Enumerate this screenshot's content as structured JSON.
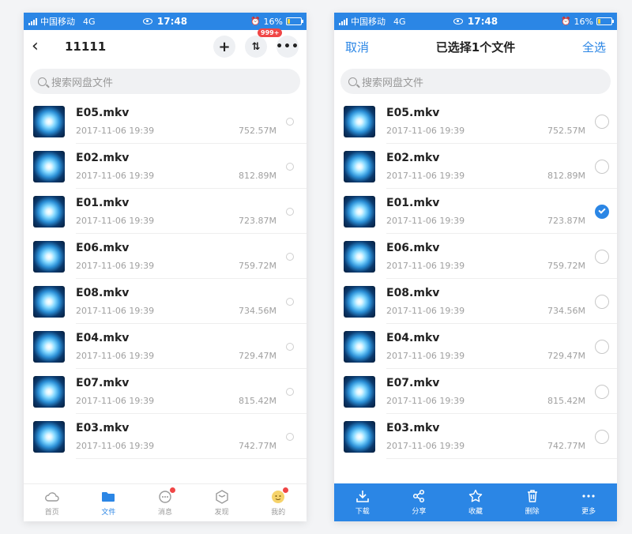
{
  "status_bar": {
    "carrier": "中国移动",
    "network": "4G",
    "time": "17:48",
    "battery": "16%"
  },
  "left": {
    "folder_title": "11111",
    "badge": "999+",
    "search_placeholder": "搜索网盘文件",
    "tabs": [
      {
        "label": "首页",
        "icon": "cloud-icon"
      },
      {
        "label": "文件",
        "icon": "folder-icon"
      },
      {
        "label": "消息",
        "icon": "message-icon"
      },
      {
        "label": "发现",
        "icon": "discover-icon"
      },
      {
        "label": "我的",
        "icon": "profile-icon"
      }
    ]
  },
  "right": {
    "cancel": "取消",
    "title": "已选择1个文件",
    "select_all": "全选",
    "search_placeholder": "搜索网盘文件",
    "actions": [
      {
        "label": "下载",
        "icon": "download-icon"
      },
      {
        "label": "分享",
        "icon": "share-icon"
      },
      {
        "label": "收藏",
        "icon": "star-icon"
      },
      {
        "label": "删除",
        "icon": "trash-icon"
      },
      {
        "label": "更多",
        "icon": "more-icon"
      }
    ]
  },
  "files": [
    {
      "name": "E05.mkv",
      "date": "2017-11-06 19:39",
      "size": "752.57M",
      "selected": false
    },
    {
      "name": "E02.mkv",
      "date": "2017-11-06 19:39",
      "size": "812.89M",
      "selected": false
    },
    {
      "name": "E01.mkv",
      "date": "2017-11-06 19:39",
      "size": "723.87M",
      "selected": true
    },
    {
      "name": "E06.mkv",
      "date": "2017-11-06 19:39",
      "size": "759.72M",
      "selected": false
    },
    {
      "name": "E08.mkv",
      "date": "2017-11-06 19:39",
      "size": "734.56M",
      "selected": false
    },
    {
      "name": "E04.mkv",
      "date": "2017-11-06 19:39",
      "size": "729.47M",
      "selected": false
    },
    {
      "name": "E07.mkv",
      "date": "2017-11-06 19:39",
      "size": "815.42M",
      "selected": false
    },
    {
      "name": "E03.mkv",
      "date": "2017-11-06 19:39",
      "size": "742.77M",
      "selected": false
    }
  ],
  "colors": {
    "accent": "#2b86e5",
    "badge": "#f04646"
  }
}
